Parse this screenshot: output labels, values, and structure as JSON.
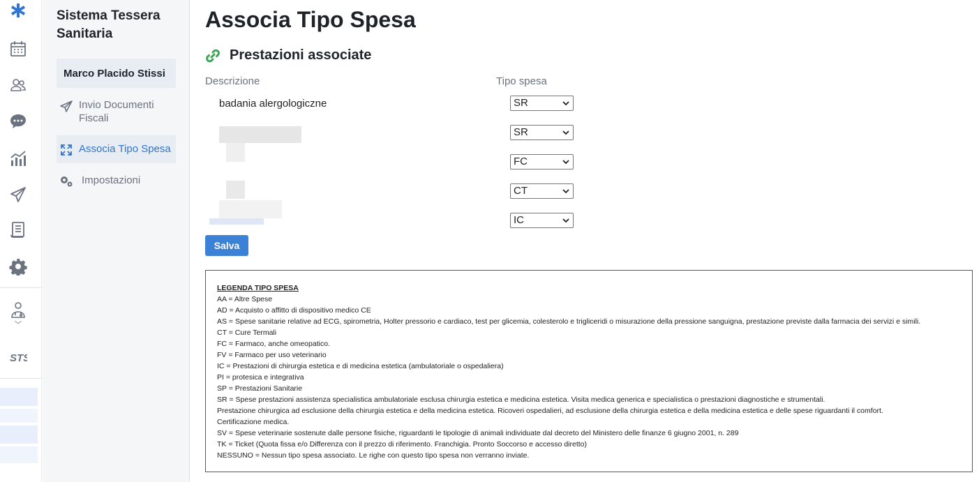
{
  "sidebar": {
    "app_title": "Sistema Tessera Sanitaria",
    "user_name": "Marco Placido Stissi",
    "items": [
      {
        "label": "Invio Documenti Fiscali",
        "icon": "send-icon",
        "active": false
      },
      {
        "label": "Associa Tipo Spesa",
        "icon": "link-arrows-icon",
        "active": true
      },
      {
        "label": "Impostazioni",
        "icon": "gears-icon",
        "active": false
      }
    ]
  },
  "rail": {
    "icons": [
      "app-logo-icon",
      "calendar-icon",
      "users-icon",
      "chat-icon",
      "chart-icon",
      "send-icon",
      "document-icon",
      "gear-icon",
      "doctor-icon",
      "sts-logo-icon"
    ],
    "accent_color": "#2f74d0"
  },
  "main": {
    "page_title": "Associa Tipo Spesa",
    "section_title": "Prestazioni associate",
    "section_icon": "link-icon",
    "section_icon_color": "#3aa655",
    "col_description": "Descrizione",
    "col_tipo_spesa": "Tipo spesa",
    "rows": [
      {
        "description": "badania alergologiczne",
        "tipo_spesa": "SR"
      },
      {
        "description": "",
        "tipo_spesa": "SR"
      },
      {
        "description": "",
        "tipo_spesa": "FC"
      },
      {
        "description": "",
        "tipo_spesa": "CT"
      },
      {
        "description": "",
        "tipo_spesa": "IC"
      }
    ],
    "save_label": "Salva",
    "save_color": "#3b82d6"
  },
  "legend": {
    "title": "LEGENDA TIPO SPESA",
    "lines": [
      "AA = Altre Spese",
      "AD = Acquisto o affitto di dispositivo medico CE",
      "AS = Spese sanitarie relative ad ECG, spirometria, Holter pressorio e cardiaco, test per glicemia, colesterolo e trigliceridi o misurazione della pressione sanguigna, prestazione previste dalla farmacia dei servizi e simili.",
      "CT = Cure Termali",
      "FC = Farmaco, anche omeopatico.",
      "FV = Farmaco per uso veterinario",
      "IC = Prestazioni di chirurgia estetica e di medicina estetica (ambulatoriale o ospedaliera)",
      "PI = protesica e integrativa",
      "SP = Prestazioni Sanitarie",
      "SR = Spese prestazioni assistenza specialistica ambulatoriale esclusa chirurgia estetica e medicina estetica. Visita medica generica e specialistica o prestazioni diagnostiche e strumentali.",
      "Prestazione chirurgica ad esclusione della chirurgia estetica e della medicina estetica. Ricoveri ospedalieri, ad esclusione della chirurgia estetica e della medicina estetica e delle spese riguardanti il comfort.",
      "Certificazione medica.",
      "SV = Spese veterinarie sostenute dalle persone fisiche, riguardanti le tipologie di animali individuate dal decreto del Ministero delle finanze 6 giugno 2001, n. 289",
      "TK = Ticket (Quota fissa e/o Differenza con il prezzo di riferimento. Franchigia. Pronto Soccorso e accesso diretto)",
      "NESSUNO = Nessun tipo spesa associato. Le righe con questo tipo spesa non verranno inviate."
    ]
  }
}
